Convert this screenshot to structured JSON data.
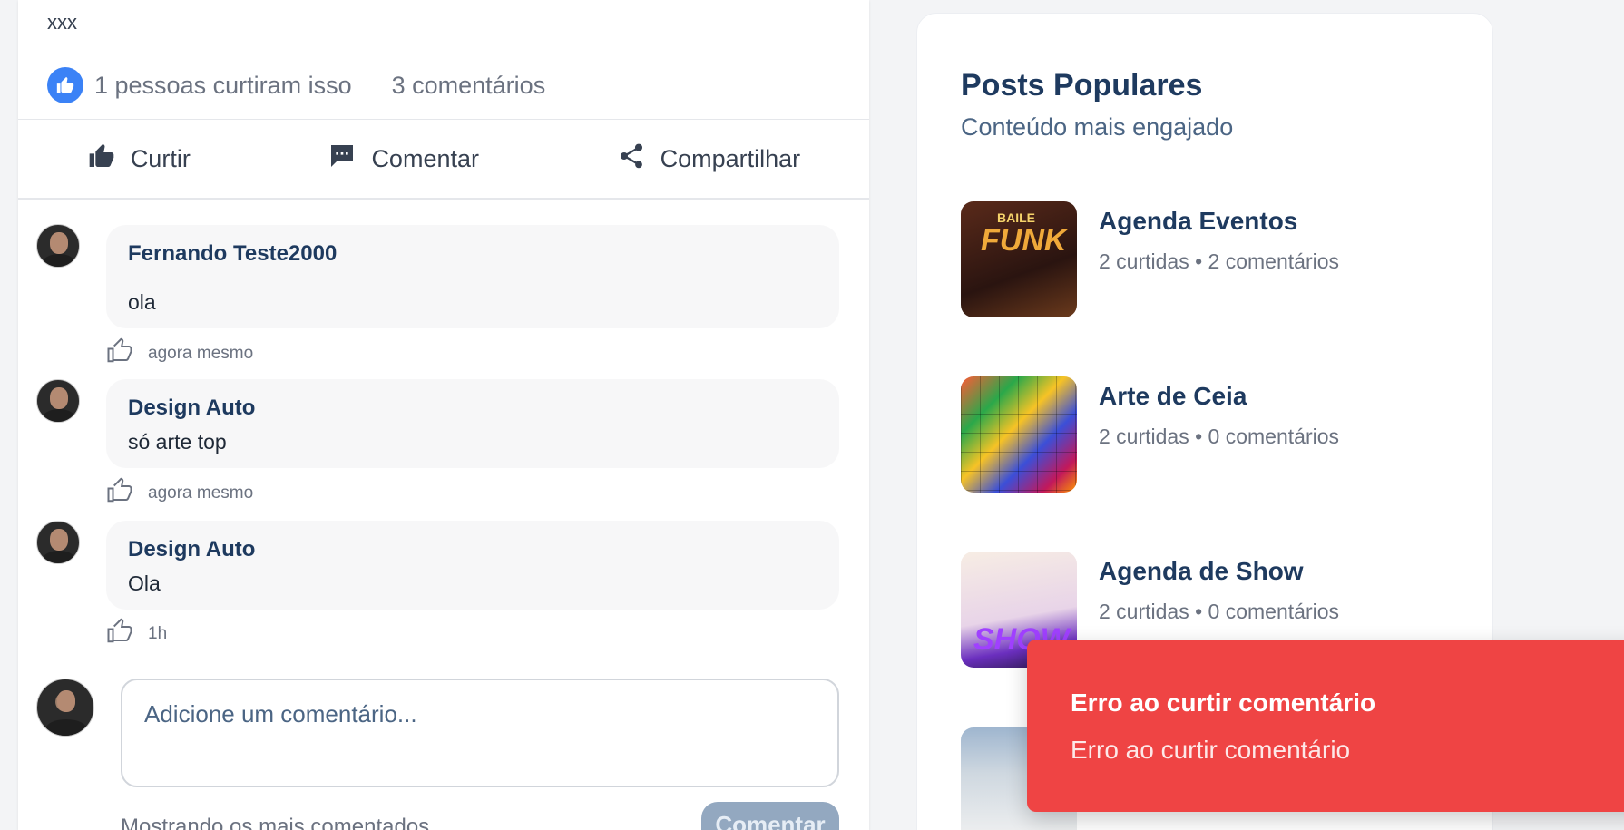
{
  "post": {
    "text": "xxx",
    "likes_text": "1 pessoas curtiram isso",
    "comments_count_text": "3 comentários",
    "actions": {
      "like": "Curtir",
      "comment": "Comentar",
      "share": "Compartilhar"
    }
  },
  "comments": [
    {
      "author": "Fernando Teste2000",
      "text": "ola",
      "time": "agora mesmo"
    },
    {
      "author": "Design Auto",
      "text": "só arte top",
      "time": "agora mesmo"
    },
    {
      "author": "Design Auto",
      "text": "Ola",
      "time": "1h"
    }
  ],
  "composer": {
    "placeholder": "Adicione um comentário...",
    "hint": "Mostrando os mais comentados",
    "submit_label": "Comentar"
  },
  "popular": {
    "title": "Posts Populares",
    "subtitle": "Conteúdo mais engajado",
    "items": [
      {
        "name": "Agenda Eventos",
        "stats": "2 curtidas • 2 comentários",
        "thumb_text": [
          "BAILE",
          "FUNK"
        ]
      },
      {
        "name": "Arte de Ceia",
        "stats": "2 curtidas • 0 comentários"
      },
      {
        "name": "Agenda de Show",
        "stats": "2 curtidas • 0 comentários",
        "thumb_text": [
          "SHOW"
        ]
      },
      {
        "name": "",
        "stats": ""
      }
    ]
  },
  "toast": {
    "title": "Erro ao curtir comentário",
    "message": "Erro ao curtir comentário",
    "color": "#ef4444"
  },
  "colors": {
    "accent": "#3b82f6",
    "heading": "#1e3a5f",
    "error": "#ef4444"
  }
}
